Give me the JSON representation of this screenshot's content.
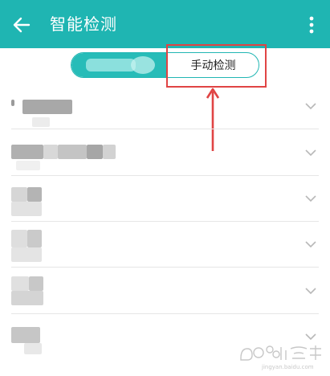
{
  "header": {
    "title": "智能检测",
    "back_icon": "arrow-left-icon",
    "more_icon": "more-vertical-icon",
    "background_color": "#1fb5b2"
  },
  "segment": {
    "active_tab_label": "",
    "inactive_tab_label": "手动检测",
    "accent_color": "#21b6b3"
  },
  "annotation": {
    "box_color": "#e04444",
    "arrow_icon": "arrow-up-icon"
  },
  "list": {
    "rows": [
      {
        "label": "",
        "chevron_icon": "chevron-down-icon"
      },
      {
        "label": "",
        "chevron_icon": "chevron-down-icon"
      },
      {
        "label": "",
        "chevron_icon": "chevron-down-icon"
      },
      {
        "label": "",
        "chevron_icon": "chevron-down-icon"
      },
      {
        "label": "",
        "chevron_icon": "chevron-down-icon"
      },
      {
        "label": "",
        "chevron_icon": "chevron-down-icon"
      }
    ]
  },
  "watermark": {
    "brand_icon": "baidu-jingyan-watermark"
  }
}
